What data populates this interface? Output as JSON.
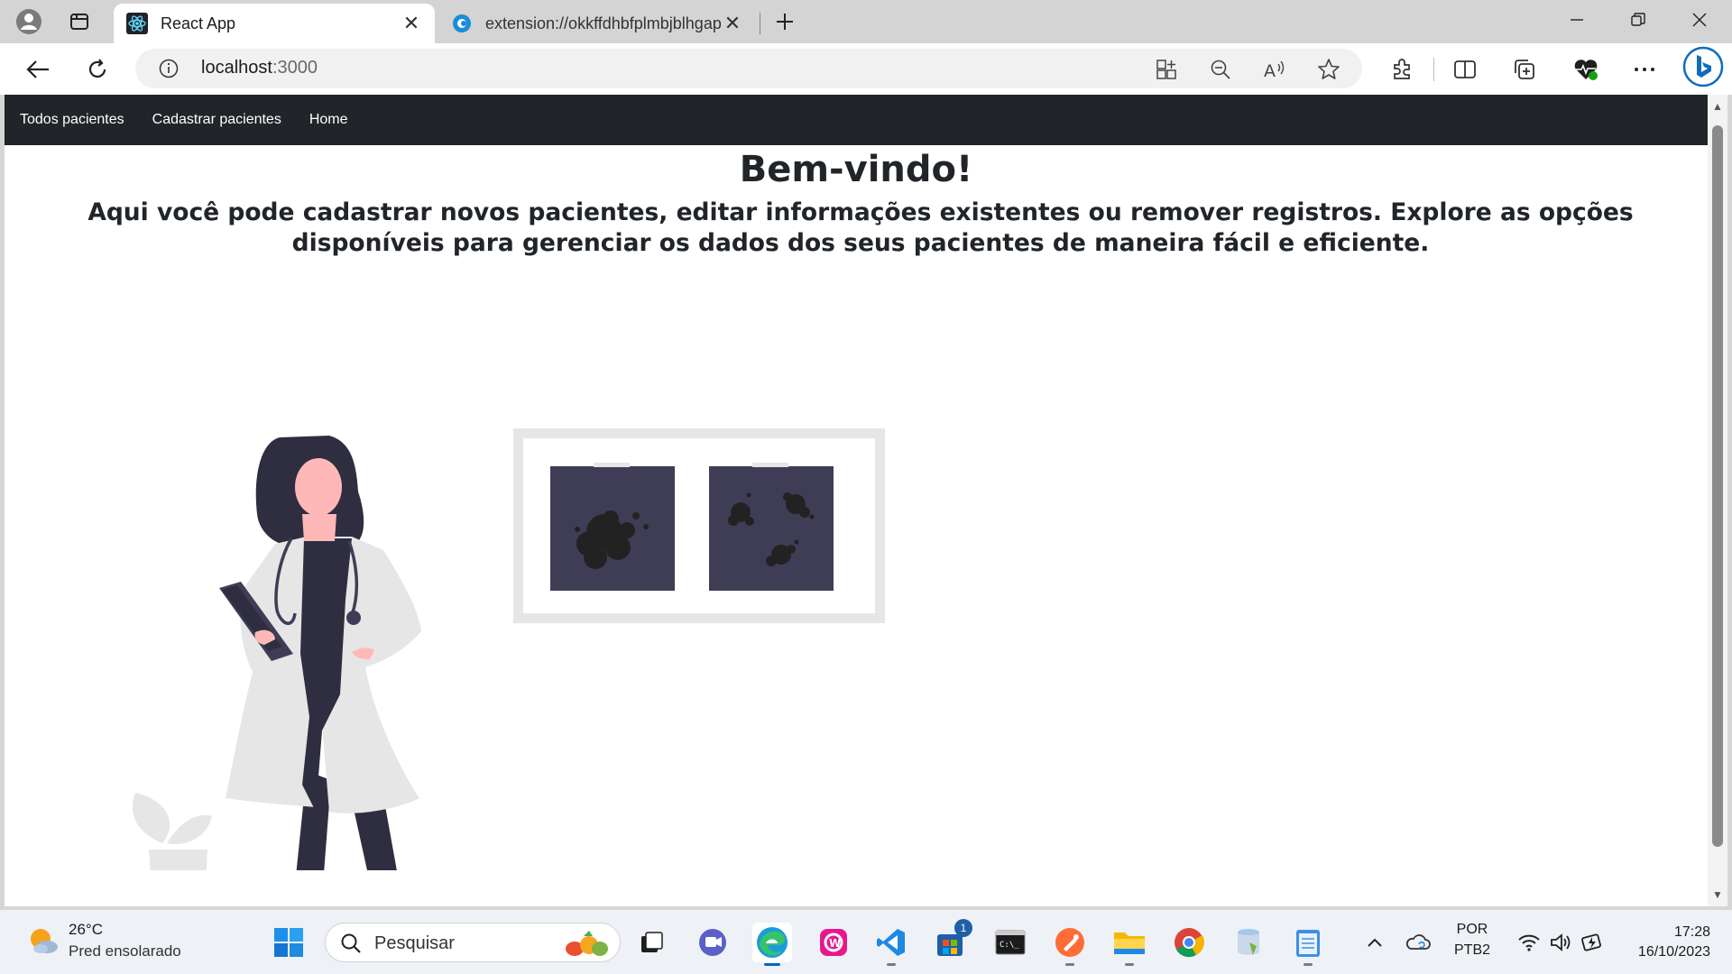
{
  "browser": {
    "tabs": [
      {
        "title": "React App",
        "active": true
      },
      {
        "title": "extension://okkffdhbfplmbjblhgapnchjinanmnij/",
        "active": false
      }
    ],
    "address": {
      "host": "localhost",
      "port": ":3000"
    }
  },
  "page": {
    "nav": [
      "Todos pacientes",
      "Cadastrar pacientes",
      "Home"
    ],
    "title": "Bem-vindo!",
    "description": "Aqui você pode cadastrar novos pacientes, editar informações existentes ou remover registros. Explore as opções disponíveis para gerenciar os dados dos seus pacientes de maneira fácil e eficiente.",
    "colors": {
      "navbar": "#212529",
      "xray": "#3f3d56",
      "coat": "#e6e6e6",
      "skin": "#ffb8b8",
      "hair": "#2f2e41"
    }
  },
  "taskbar": {
    "weather": {
      "temp": "26°C",
      "condition": "Pred ensolarado"
    },
    "search_placeholder": "Pesquisar",
    "store_badge": "1",
    "lang": {
      "line1": "POR",
      "line2": "PTB2"
    },
    "clock": {
      "time": "17:28",
      "date": "16/10/2023"
    }
  }
}
